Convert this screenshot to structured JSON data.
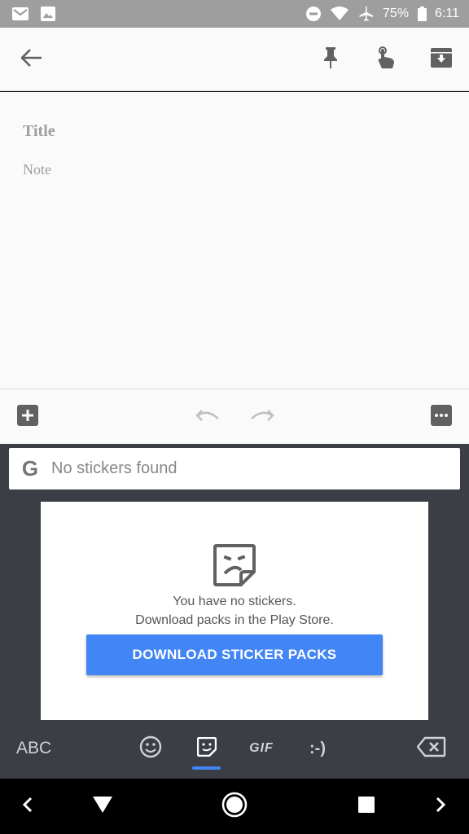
{
  "status_bar": {
    "battery": "75%",
    "time": "6:11",
    "icons": [
      "gmail-icon",
      "photos-icon",
      "dnd-icon",
      "wifi-icon",
      "airplane-icon",
      "battery-icon"
    ]
  },
  "app_bar": {
    "icons": [
      "back-arrow-icon",
      "pin-icon",
      "reminder-icon",
      "archive-icon"
    ]
  },
  "note": {
    "title_placeholder": "Title",
    "body_placeholder": "Note"
  },
  "toolbar": {
    "icons": [
      "add-box-icon",
      "undo-icon",
      "redo-icon",
      "more-icon"
    ]
  },
  "keyboard": {
    "search_logo": "G",
    "search_placeholder": "No stickers found",
    "empty_line1": "You have no stickers.",
    "empty_line2": "Download packs in the Play Store.",
    "download_button": "DOWNLOAD STICKER PACKS",
    "tabs": {
      "abc": "ABC",
      "gif": "GIF",
      "emoticon": ":-)"
    },
    "active_tab": "stickers",
    "accent": "#4285f4"
  },
  "nav_bar": {
    "icons": [
      "nav-left-icon",
      "nav-back-icon",
      "nav-home-icon",
      "nav-recents-icon",
      "nav-right-icon"
    ]
  }
}
